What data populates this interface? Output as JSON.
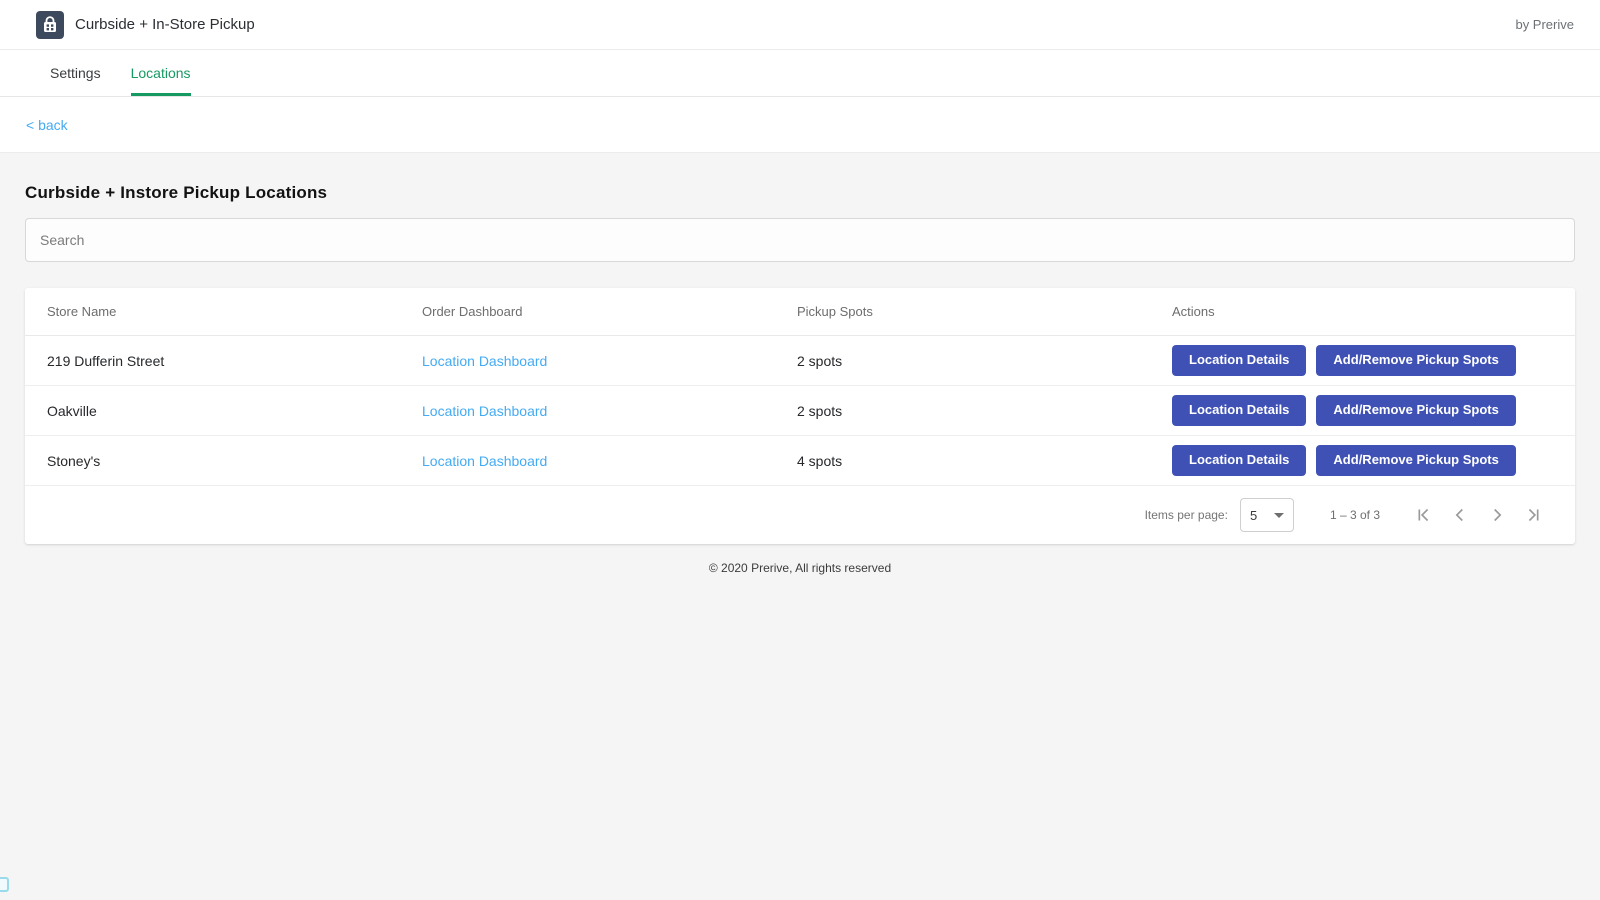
{
  "header": {
    "title": "Curbside + In-Store Pickup",
    "byline": "by Prerive",
    "app_icon": "shopping-bag-icon"
  },
  "tabs": [
    {
      "label": "Settings",
      "active": false
    },
    {
      "label": "Locations",
      "active": true
    }
  ],
  "back_link": "< back",
  "page": {
    "heading": "Curbside + Instore Pickup Locations"
  },
  "search": {
    "placeholder": "Search"
  },
  "table": {
    "columns": [
      "Store Name",
      "Order Dashboard",
      "Pickup Spots",
      "Actions"
    ],
    "rows": [
      {
        "store_name": "219 Dufferin Street",
        "order_dashboard": "Location Dashboard",
        "pickup_spots": "2 spots"
      },
      {
        "store_name": "Oakville",
        "order_dashboard": "Location Dashboard",
        "pickup_spots": "2 spots"
      },
      {
        "store_name": "Stoney's",
        "order_dashboard": "Location Dashboard",
        "pickup_spots": "4 spots"
      }
    ],
    "action_labels": {
      "details": "Location Details",
      "add_remove": "Add/Remove Pickup Spots"
    }
  },
  "paginator": {
    "items_per_page_label": "Items per page:",
    "page_size": "5",
    "range_label": "1 – 3 of 3",
    "icons": [
      "first-page-icon",
      "chevron-left-icon",
      "chevron-right-icon",
      "last-page-icon"
    ]
  },
  "footer": {
    "copyright": "© 2020 Prerive, All rights reserved"
  },
  "colors": {
    "tab_active_green": "#169a62",
    "link_blue": "#44abf3",
    "button_indigo": "#3f51b5",
    "icon_tile_navy": "#3d4a5d",
    "page_background": "#f5f5f6"
  }
}
